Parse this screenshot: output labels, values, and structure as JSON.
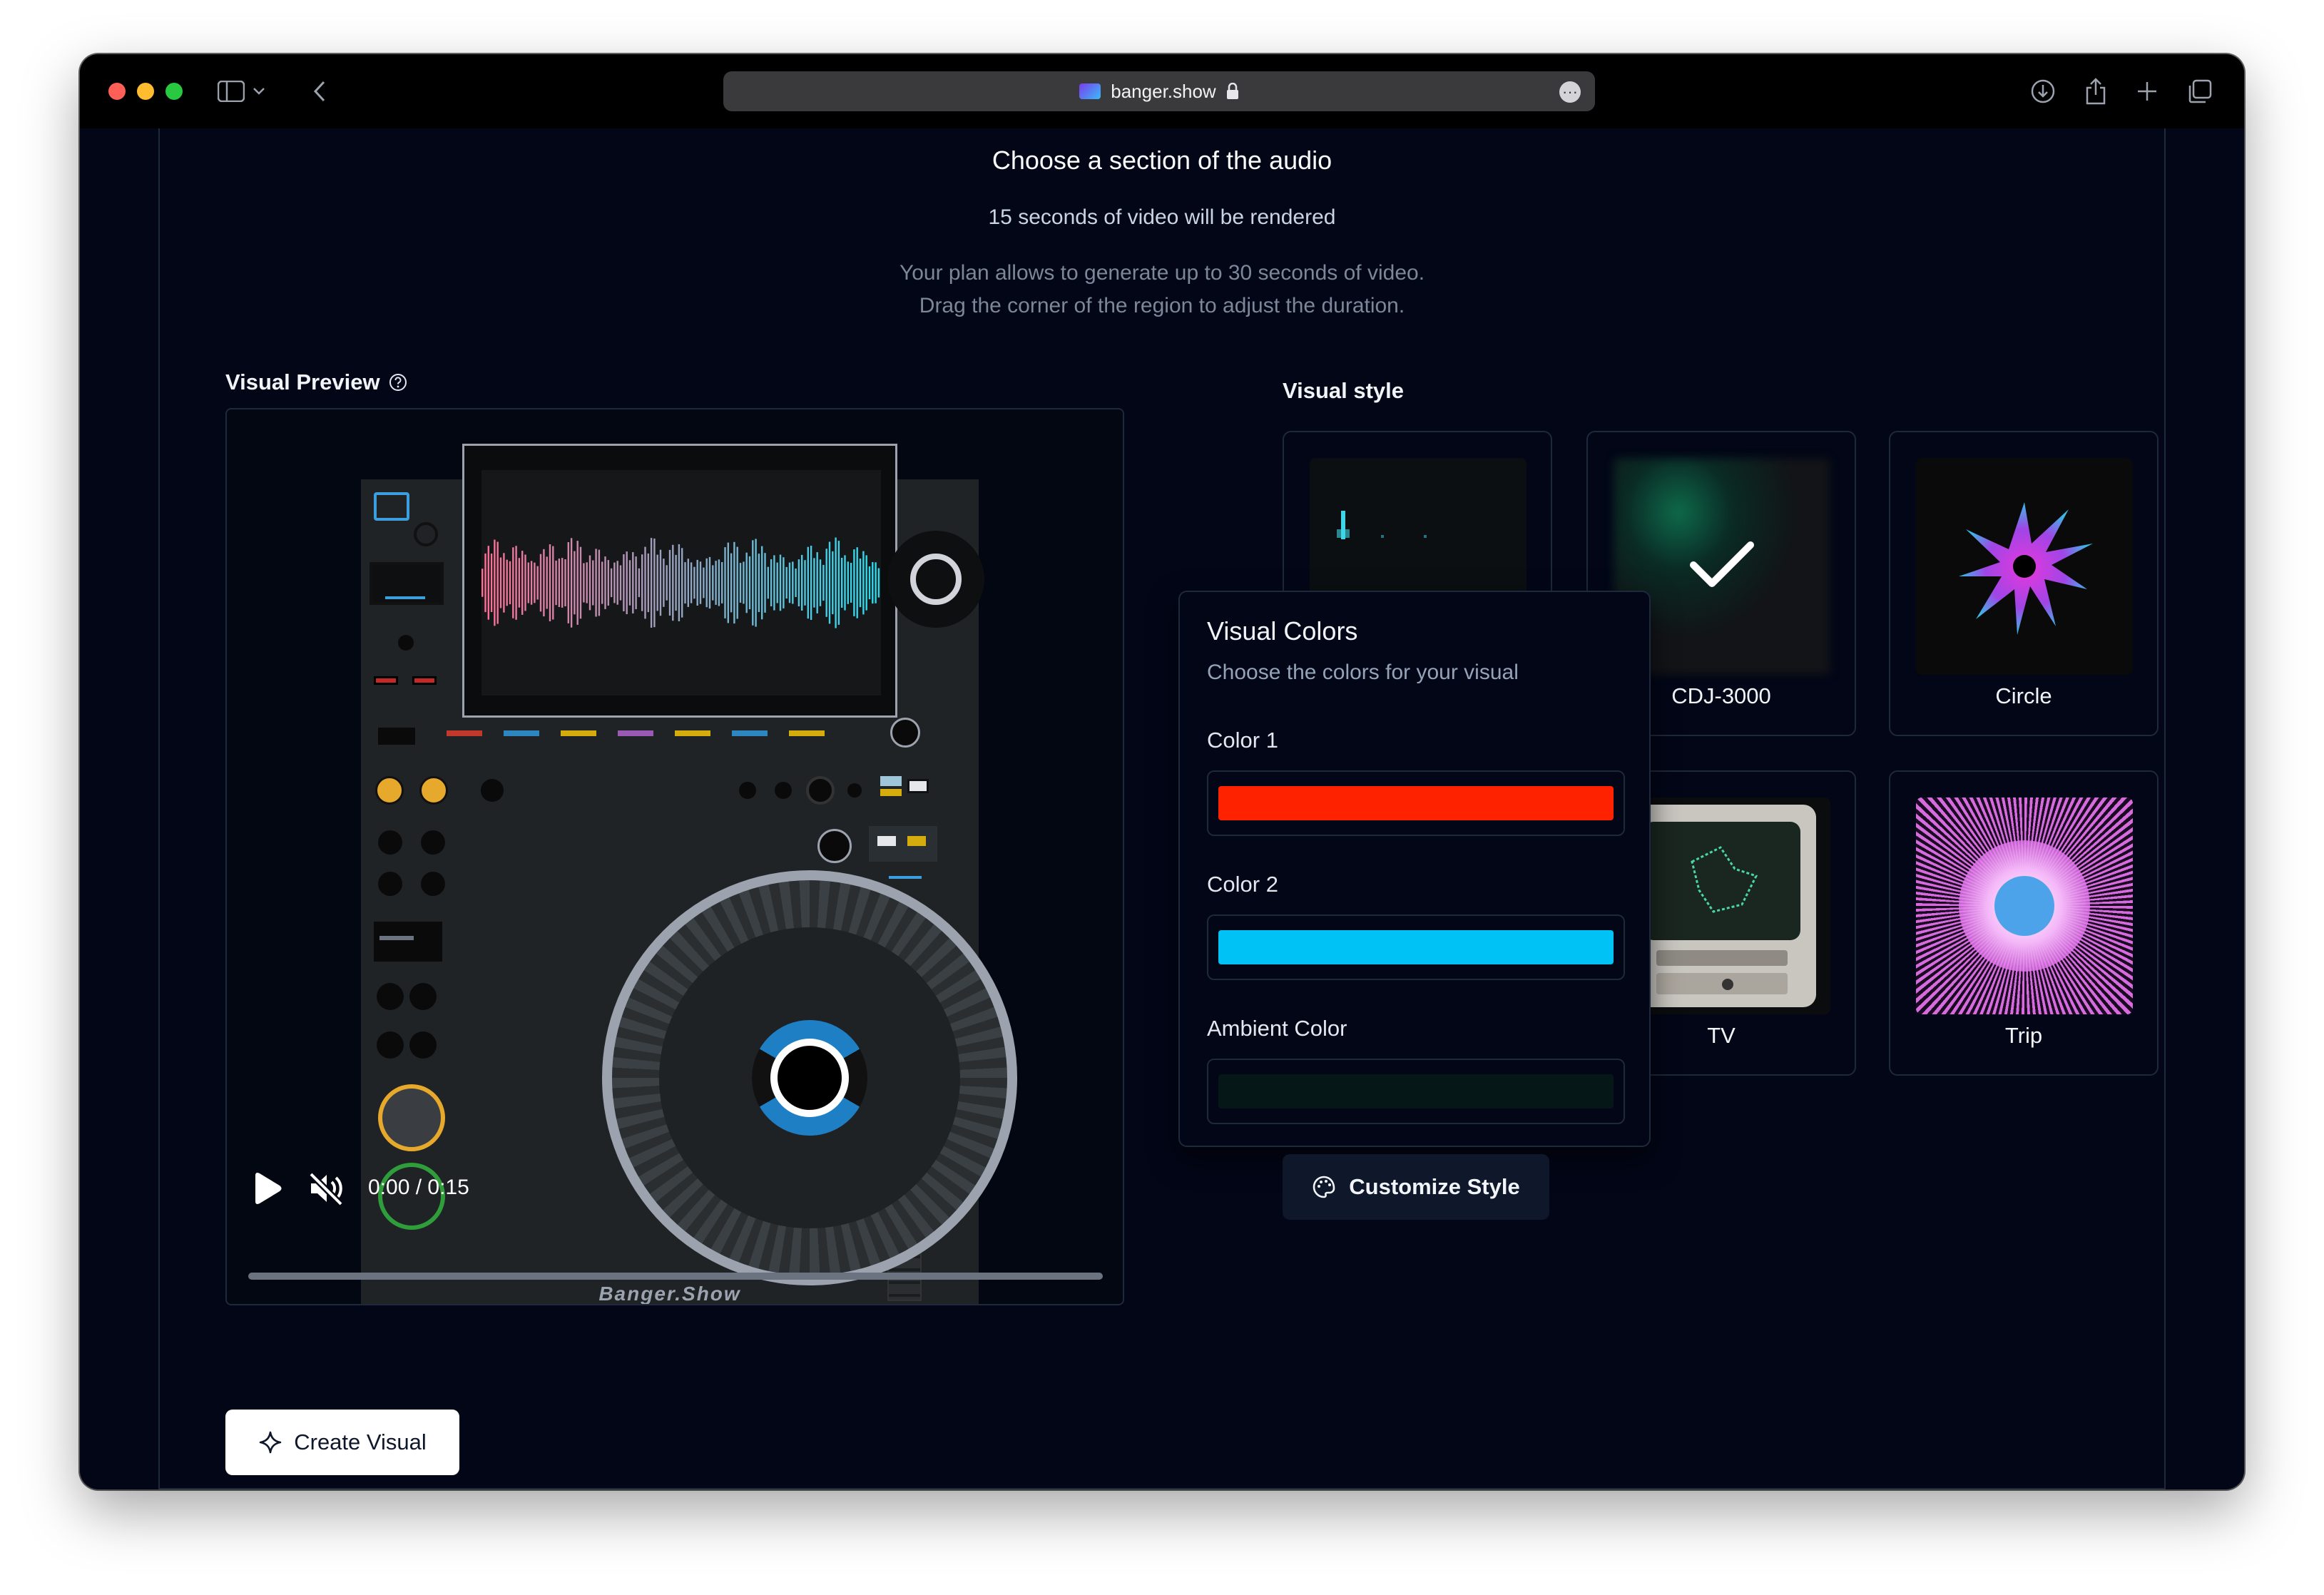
{
  "browser": {
    "url": "banger.show",
    "lock_icon": "lock-icon",
    "more_icon": "ellipsis-icon"
  },
  "section": {
    "title": "Choose a section of the audio",
    "subtitle": "15 seconds of video will be rendered",
    "note_line1": "Your plan allows to generate up to 30 seconds of video.",
    "note_line2": "Drag the corner of the region to adjust the duration."
  },
  "preview": {
    "label": "Visual Preview",
    "time": "0:00 / 0:15",
    "brand": "Banger.Show"
  },
  "styles": {
    "label": "Visual style",
    "cards": [
      {
        "label": "",
        "selected": false
      },
      {
        "label": "CDJ-3000",
        "selected": true
      },
      {
        "label": "Circle",
        "selected": false
      },
      {
        "label": "",
        "selected": false
      },
      {
        "label": "TV",
        "selected": false
      },
      {
        "label": "Trip",
        "selected": false
      }
    ]
  },
  "colors_popover": {
    "title": "Visual Colors",
    "description": "Choose the colors for your visual",
    "color1_label": "Color 1",
    "color1_value": "#ff2200",
    "color2_label": "Color 2",
    "color2_value": "#00c2f5",
    "ambient_label": "Ambient Color",
    "ambient_value": "#051817"
  },
  "buttons": {
    "customize": "Customize Style",
    "create": "Create Visual"
  }
}
